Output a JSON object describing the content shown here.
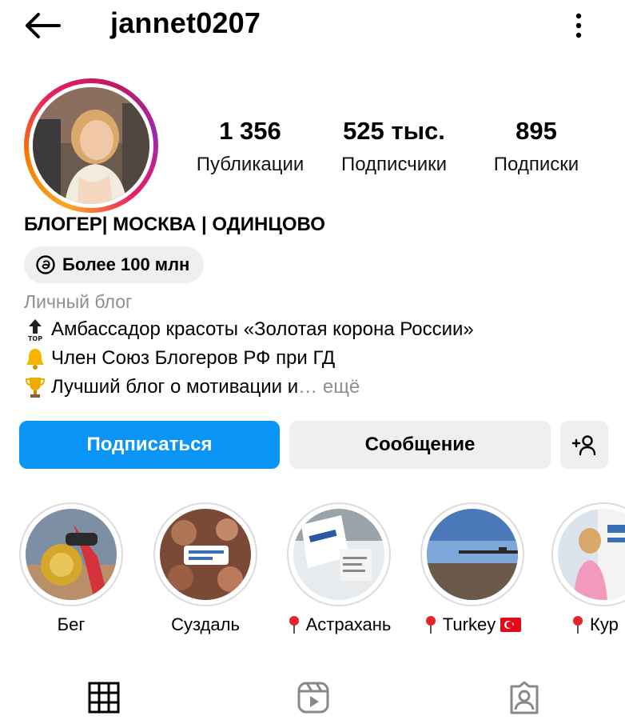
{
  "header": {
    "username": "jannet0207",
    "back_icon": "arrow-left-icon",
    "menu_icon": "more-vertical-icon"
  },
  "profile": {
    "avatar": "profile-photo",
    "stats": [
      {
        "value": "1 356",
        "label": "Публикации"
      },
      {
        "value": "525 тыс.",
        "label": "Подписчики"
      },
      {
        "value": "895",
        "label": "Подписки"
      }
    ],
    "bio_title": "БЛОГЕР| МОСКВА | ОДИНЦОВО",
    "threads_badge": "Более 100 млн",
    "category": "Личный блог",
    "bio_lines": [
      {
        "emoji": "top-arrow-emoji",
        "text": "Амбассадор красоты «Золотая корона России»"
      },
      {
        "emoji": "bell-emoji",
        "text": "Член Союз Блогеров РФ при ГД"
      },
      {
        "emoji": "trophy-emoji",
        "text": "Лучший блог о мотивации и",
        "more": "… ещё"
      }
    ]
  },
  "actions": {
    "follow": "Подписаться",
    "message": "Сообщение",
    "add_user_icon": "add-user-icon"
  },
  "highlights": [
    {
      "label": "Бег",
      "pin": false
    },
    {
      "label": "Суздаль",
      "pin": false
    },
    {
      "label": "Астрахань",
      "pin": true
    },
    {
      "label": "Turkey",
      "pin": true,
      "flag": "turkey-flag"
    },
    {
      "label": "Кур",
      "pin": true
    }
  ],
  "tabs": [
    {
      "name": "grid-icon",
      "active": true
    },
    {
      "name": "reels-icon",
      "active": false
    },
    {
      "name": "tagged-icon",
      "active": false
    }
  ],
  "colors": {
    "primary_button": "#0a95f6",
    "secondary_button": "#efefef",
    "muted_text": "#8e8e8e",
    "highlight_ring": "#dbdbdb"
  }
}
